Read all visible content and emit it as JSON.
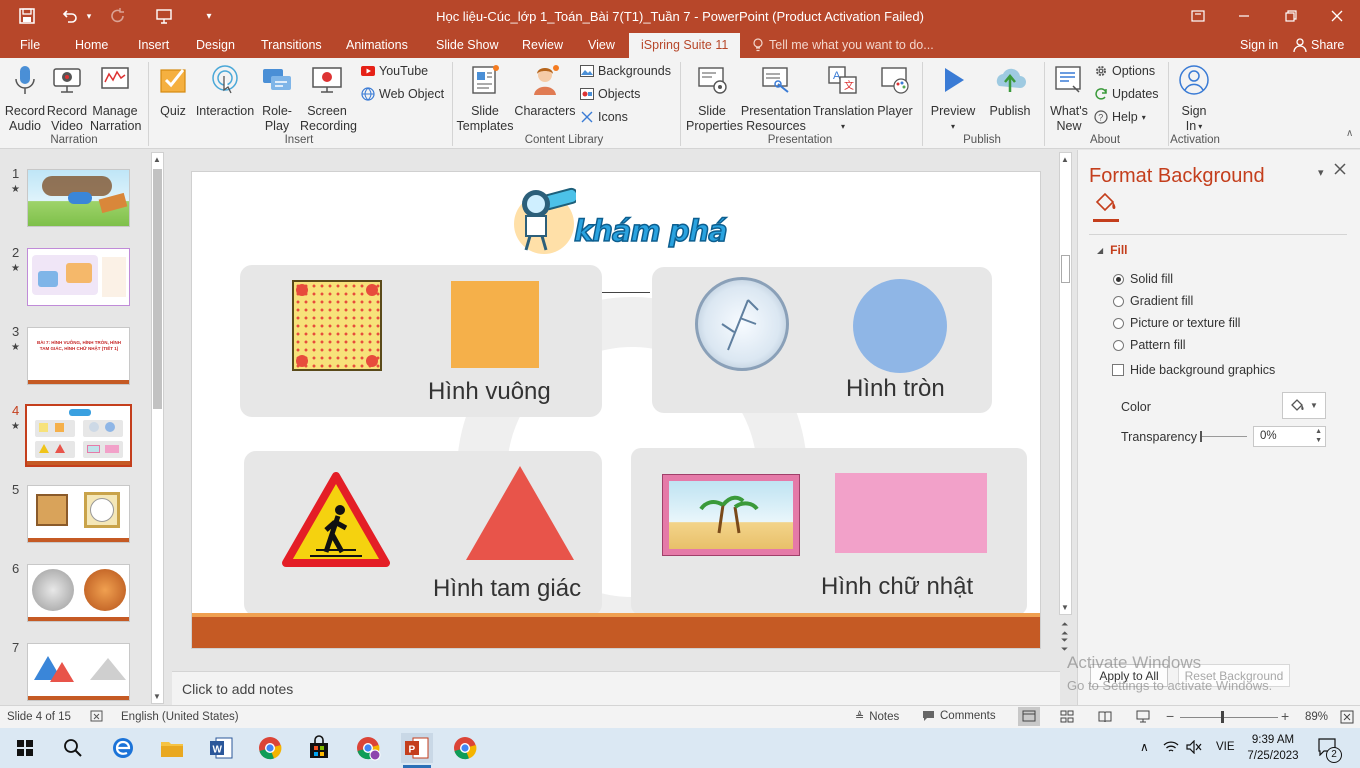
{
  "window": {
    "title": "Học liệu-Cúc_lớp 1_Toán_Bài 7(T1)_Tuần 7 - PowerPoint (Product Activation Failed)"
  },
  "tabs": {
    "file": "File",
    "home": "Home",
    "insert": "Insert",
    "design": "Design",
    "transitions": "Transitions",
    "animations": "Animations",
    "slideshow": "Slide Show",
    "review": "Review",
    "view": "View",
    "ispring": "iSpring Suite 11",
    "tellme": "Tell me what you want to do...",
    "signin": "Sign in",
    "share": "Share"
  },
  "ribbon": {
    "narration": {
      "label": "Narration",
      "record_audio": [
        "Record",
        "Audio"
      ],
      "record_video": [
        "Record",
        "Video"
      ],
      "manage_narration": [
        "Manage",
        "Narration"
      ]
    },
    "insert": {
      "label": "Insert",
      "quiz": "Quiz",
      "interaction": "Interaction",
      "roleplay": [
        "Role-",
        "Play"
      ],
      "screen_recording": [
        "Screen",
        "Recording"
      ],
      "youtube": "YouTube",
      "web_object": "Web Object"
    },
    "content_library": {
      "label": "Content Library",
      "slide_templates": [
        "Slide",
        "Templates"
      ],
      "characters": "Characters",
      "backgrounds": "Backgrounds",
      "objects": "Objects",
      "icons": "Icons"
    },
    "presentation": {
      "label": "Presentation",
      "slide_properties": [
        "Slide",
        "Properties"
      ],
      "presentation_resources": [
        "Presentation",
        "Resources"
      ],
      "translation": "Translation",
      "player": "Player"
    },
    "publish": {
      "label": "Publish",
      "preview": "Preview",
      "publish": "Publish"
    },
    "about": {
      "label": "About",
      "whats_new": [
        "What's",
        "New"
      ],
      "options": "Options",
      "updates": "Updates",
      "help": "Help"
    },
    "activation": {
      "label": "Activation",
      "sign_in": [
        "Sign",
        "In"
      ]
    }
  },
  "thumbnails": {
    "selected": 4,
    "items": [
      {
        "num": "1",
        "star": "★"
      },
      {
        "num": "2",
        "star": "★"
      },
      {
        "num": "3",
        "star": "★",
        "text": "BÀI 7: HÌNH VUÔNG, HÌNH TRÒN, HÌNH TAM GIÁC, HÌNH CHỮ NHẬT (TIẾT 1)"
      },
      {
        "num": "4",
        "star": "★"
      },
      {
        "num": "5",
        "star": ""
      },
      {
        "num": "6",
        "star": ""
      },
      {
        "num": "7",
        "star": ""
      }
    ]
  },
  "slide": {
    "header": "khám phá",
    "captions": {
      "square": "Hình vuông",
      "circle": "Hình tròn",
      "triangle": "Hình tam giác",
      "rectangle": "Hình chữ nhật"
    },
    "colors": {
      "square": "#f5b04a",
      "circle": "#8fb6e6",
      "triangle": "#e8544a",
      "rectangle": "#f2a1c9",
      "footer": "#c55a24"
    }
  },
  "notes": {
    "placeholder": "Click to add notes"
  },
  "format_pane": {
    "title": "Format Background",
    "section": "Fill",
    "options": [
      {
        "label": "Solid fill",
        "checked": true
      },
      {
        "label": "Gradient fill",
        "checked": false
      },
      {
        "label": "Picture or texture fill",
        "checked": false
      },
      {
        "label": "Pattern fill",
        "checked": false
      }
    ],
    "hide_graphics": "Hide background graphics",
    "color_label": "Color",
    "transparency_label": "Transparency",
    "transparency_value": "0%",
    "apply_all": "Apply to All",
    "reset": "Reset Background",
    "watermark_title": "Activate Windows",
    "watermark_sub": "Go to Settings to activate Windows."
  },
  "status": {
    "slide": "Slide 4 of 15",
    "language": "English (United States)",
    "notes": "Notes",
    "comments": "Comments",
    "zoom": "89%"
  },
  "taskbar": {
    "time": "9:39 AM",
    "date": "7/25/2023",
    "lang": "VIE",
    "badge": "2"
  }
}
